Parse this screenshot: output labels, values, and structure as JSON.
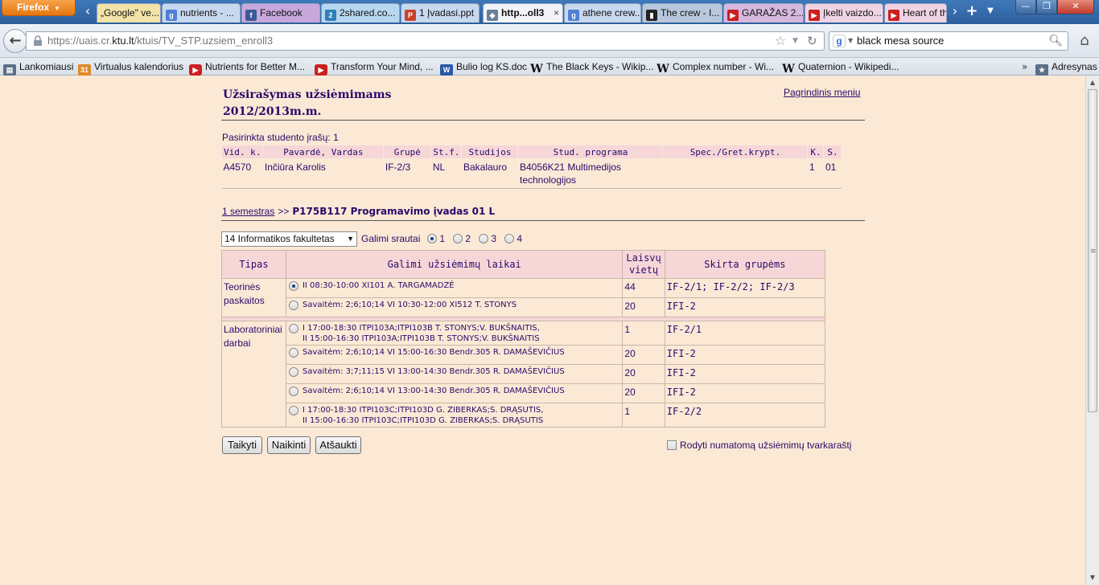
{
  "browser": {
    "app_button": "Firefox",
    "tabs": [
      {
        "label": "„Google\" ve...",
        "icon": "google-docs"
      },
      {
        "label": "nutrients - ...",
        "icon": "google"
      },
      {
        "label": "Facebook",
        "icon": "facebook"
      },
      {
        "label": "2shared.co...",
        "icon": "2shared"
      },
      {
        "label": "1 Įvadasi.ppt",
        "icon": "powerpoint"
      },
      {
        "label": "http...oll3",
        "icon": "ktu",
        "active": true
      },
      {
        "label": "athene crew...",
        "icon": "google"
      },
      {
        "label": "The crew - I...",
        "icon": "imdb"
      },
      {
        "label": "GARAŽAS 2...",
        "icon": "youtube"
      },
      {
        "label": "Įkelti vaizdo...",
        "icon": "youtube"
      },
      {
        "label": "Heart of th",
        "icon": "youtube"
      }
    ],
    "url_prefix": "https://uais.cr.",
    "url_domain": "ktu.lt",
    "url_path": "/ktuis/TV_STP.uzsiem_enroll3",
    "search_value": "black mesa source",
    "bookmarks": [
      {
        "label": "Lankomiausi",
        "icon": "library"
      },
      {
        "label": "Virtualus kalendorius",
        "icon": "calendar"
      },
      {
        "label": "Nutrients for Better M...",
        "icon": "youtube"
      },
      {
        "label": "Transform Your Mind, ...",
        "icon": "youtube"
      },
      {
        "label": "Bulio log KS.doc",
        "icon": "word"
      },
      {
        "label": "The Black Keys - Wikip...",
        "icon": "wikipedia"
      },
      {
        "label": "Complex number - Wi...",
        "icon": "wikipedia"
      },
      {
        "label": "Quaternion - Wikipedi...",
        "icon": "wikipedia"
      }
    ],
    "bookmarks_more": "»",
    "bookmarks_folder": "Adresynas"
  },
  "page": {
    "title_line1": "Užsirašymas užsiėmimams",
    "title_line2": "2012/2013m.m.",
    "main_menu": "Pagrindinis meniu",
    "selected_records": "Pasirinkta studento įrašų: 1",
    "student_table": {
      "headers": [
        "Vid. k.",
        "Pavardė, Vardas",
        "Grupė",
        "St.f.",
        "Studijos",
        "Stud. programa",
        "Spec./Gret.krypt.",
        "K.",
        "S."
      ],
      "row": [
        "A4570",
        "Inčiūra Karolis",
        "IF-2/3",
        "NL",
        "Bakalauro",
        "B4056K21 Multimedijos technologijos",
        "",
        "1",
        "01"
      ]
    },
    "breadcrumb": {
      "semester_link": "1 semestras",
      "separator": ">>",
      "course": "P175B117 Programavimo įvadas 01 L"
    },
    "filter": {
      "faculty_selected": "14 Informatikos fakultetas",
      "streams_label": "Galimi srautai",
      "streams": [
        "1",
        "2",
        "3",
        "4"
      ],
      "selected_stream": "1"
    },
    "times_table": {
      "headers": [
        "Tipas",
        "Galimi užsiėmimų laikai",
        "Laisvų vietų",
        "Skirta grupėms"
      ],
      "lectures_label": "Teorinės paskaitos",
      "lectures": [
        {
          "time": "II 08:30-10:00 XI101 A. TARGAMADZĖ",
          "free": "44",
          "groups": "IF-2/1; IF-2/2; IF-2/3",
          "selected": true
        },
        {
          "time": "Savaitėm: 2;6;10;14 VI 10:30-12:00 XI512 T. STONYS",
          "free": "20",
          "groups": "IFI-2",
          "selected": false
        }
      ],
      "labs_label": "Laboratoriniai darbai",
      "labs": [
        {
          "line1": "I 17:00-18:30 ITPI103A;ITPI103B T. STONYS;V. BUKŠNAITIS,",
          "line2": "II 15:00-16:30 ITPI103A;ITPI103B T. STONYS;V. BUKŠNAITIS",
          "free": "1",
          "groups": "IF-2/1"
        },
        {
          "line1": "Savaitėm: 2;6;10;14 VI 15:00-16:30 Bendr.305 R. DAMAŠEVIČIUS",
          "line2": "",
          "free": "20",
          "groups": "IFI-2"
        },
        {
          "line1": "Savaitėm: 3;7;11;15 VI 13:00-14:30 Bendr.305 R. DAMAŠEVIČIUS",
          "line2": "",
          "free": "20",
          "groups": "IFI-2"
        },
        {
          "line1": "Savaitėm: 2;6;10;14 VI 13:00-14:30 Bendr.305 R. DAMAŠEVIČIUS",
          "line2": "",
          "free": "20",
          "groups": "IFI-2"
        },
        {
          "line1": "I 17:00-18:30 ITPI103C;ITPI103D G. ZIBERKAS;S. DRĄSUTIS,",
          "line2": "II 15:00-16:30 ITPI103C;ITPI103D G. ZIBERKAS;S. DRĄSUTIS",
          "free": "1",
          "groups": "IF-2/2"
        }
      ]
    },
    "buttons": {
      "apply": "Taikyti",
      "destroy": "Naikinti",
      "cancel": "Atšaukti"
    },
    "show_schedule": "Rodyti numatomą užsiėmimų tvarkaraštį"
  }
}
